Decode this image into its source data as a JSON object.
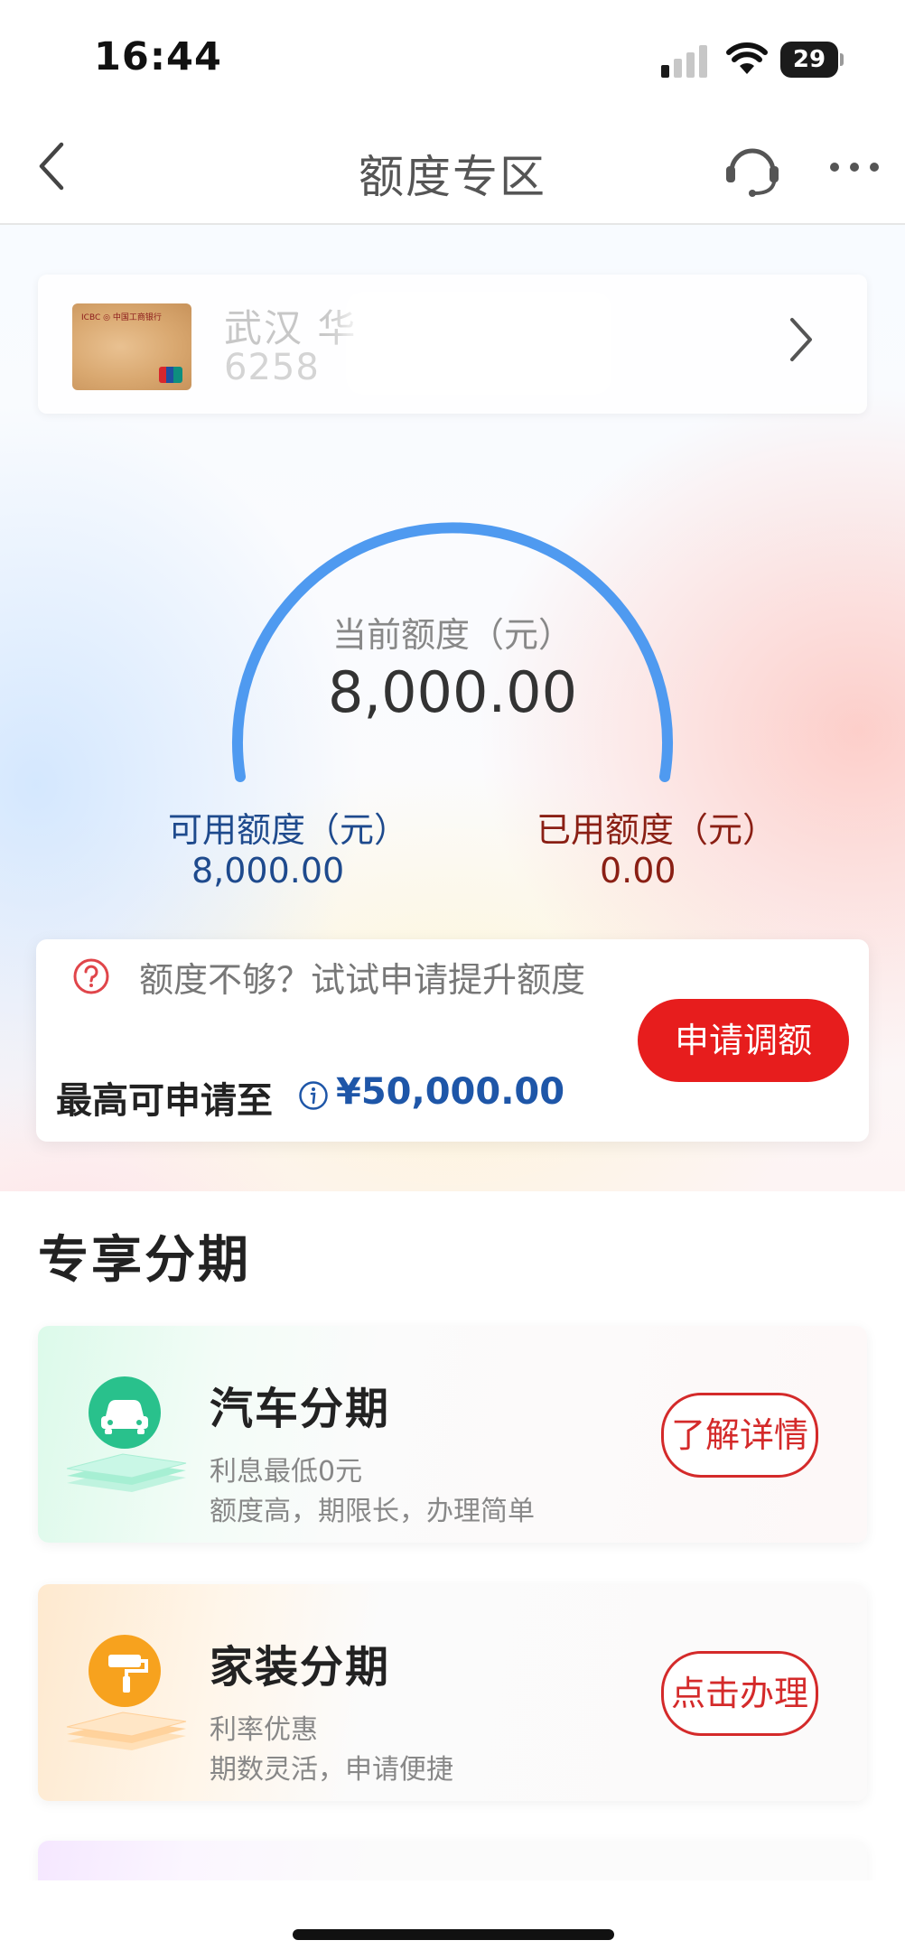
{
  "status_bar": {
    "time": "16:44",
    "battery": "29"
  },
  "nav": {
    "title": "额度专区"
  },
  "card": {
    "name": "武汉 华",
    "number": "6258"
  },
  "gauge": {
    "label": "当前额度（元）",
    "value": "8,000.00"
  },
  "available": {
    "label": "可用额度（元）",
    "value": "8,000.00"
  },
  "used": {
    "label": "已用额度（元）",
    "value": "0.00"
  },
  "increase": {
    "tip": "额度不够？试试申请提升额度",
    "max_label": "最高可申请至",
    "max_value": "¥50,000.00",
    "button": "申请调额"
  },
  "section": {
    "title": "专享分期"
  },
  "installments": [
    {
      "title": "汽车分期",
      "sub1": "利息最低0元",
      "sub2": "额度高，期限长，办理简单",
      "button": "了解详情",
      "icon": "car-icon"
    },
    {
      "title": "家装分期",
      "sub1": "利率优惠",
      "sub2": "期数灵活，申请便捷",
      "button": "点击办理",
      "icon": "paint-roller-icon"
    }
  ],
  "colors": {
    "primary_red": "#e71d1d",
    "available_blue": "#1e4a8d",
    "used_dark_red": "#8a1f14",
    "gauge_blue": "#4f9af0"
  },
  "icons": {
    "back": "chevron-left-icon",
    "customer_service": "headset-icon",
    "more": "more-dots-icon",
    "card_chevron": "chevron-right-icon",
    "question": "question-circle-icon",
    "info": "info-icon"
  }
}
